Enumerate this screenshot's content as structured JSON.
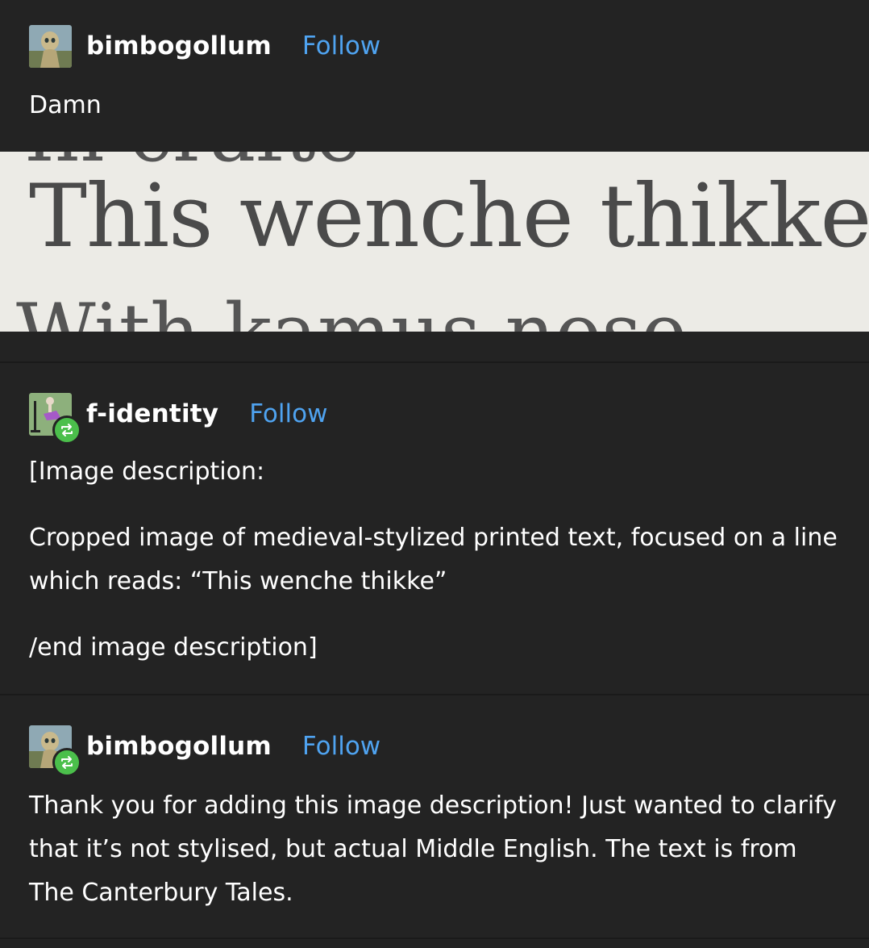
{
  "posts": [
    {
      "username": "bimbogollum",
      "follow_label": "Follow",
      "avatar": "gollum-avatar",
      "reblog": false,
      "body": [
        "Damn"
      ],
      "image_text": "This wenche thikke"
    },
    {
      "username": "f-identity",
      "follow_label": "Follow",
      "avatar": "dancer-avatar",
      "reblog": true,
      "body": [
        "[Image description:",
        "Cropped image of medieval-stylized printed text, focused on a line which reads: “This wenche thikke”",
        "/end image description]"
      ]
    },
    {
      "username": "bimbogollum",
      "follow_label": "Follow",
      "avatar": "gollum-avatar",
      "reblog": true,
      "body": [
        "Thank you for adding this image description! Just wanted to clarify that it’s not stylised, but actual Middle English. The text is from The Canterbury Tales."
      ]
    }
  ],
  "icons": {
    "reblog": "reblog-icon"
  },
  "colors": {
    "background": "#232323",
    "follow": "#4fa3f0",
    "reblog_badge": "#4bbf4b",
    "text": "#ffffff"
  }
}
